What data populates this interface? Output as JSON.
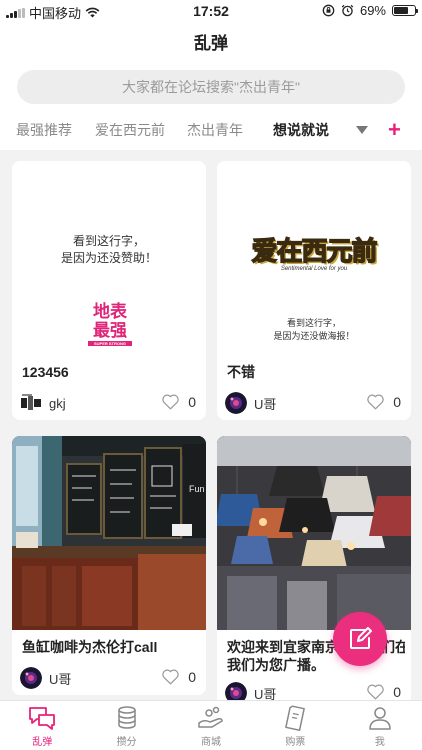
{
  "status_bar": {
    "carrier": "中国移动",
    "time": "17:52",
    "battery": "69%",
    "battery_level": 0.69
  },
  "nav": {
    "title": "乱弹"
  },
  "search": {
    "placeholder": "大家都在论坛搜索\"杰出青年\""
  },
  "tabs": [
    {
      "label": "最强推荐",
      "active": false
    },
    {
      "label": "爱在西元前",
      "active": false
    },
    {
      "label": "杰出青年",
      "active": false
    },
    {
      "label": "想说就说",
      "active": true
    }
  ],
  "tab_add_label": "+",
  "cards": [
    {
      "image_text": [
        "看到这行字，",
        "是因为还没赞助！"
      ],
      "logo_text": [
        "地表",
        "最强"
      ],
      "logo_sub": "SUPER STRONG",
      "title": "123456",
      "author": "gkj",
      "likes": "0"
    },
    {
      "image_text": [
        "看到这行字，",
        "是因为还没做海报！"
      ],
      "logo_text": [
        "爱在西元前"
      ],
      "logo_sub": "Sentimental Love for you",
      "title": "不错",
      "author": "U哥",
      "likes": "0"
    },
    {
      "title": "鱼缸咖啡为杰伦打call",
      "author": "U哥",
      "likes": "0",
      "sign_text": "Fun"
    },
    {
      "title_line1": "欢迎来到宜家南京店，我们在",
      "title_line2": "我们为您广播。",
      "author": "U哥",
      "likes": "0"
    }
  ],
  "tabbar": [
    {
      "label": "乱弹",
      "icon": "chat-bubbles-icon",
      "active": true
    },
    {
      "label": "攒分",
      "icon": "coins-icon",
      "active": false
    },
    {
      "label": "商城",
      "icon": "shop-icon",
      "active": false
    },
    {
      "label": "购票",
      "icon": "ticket-icon",
      "active": false
    },
    {
      "label": "我",
      "icon": "user-icon",
      "active": false
    }
  ],
  "colors": {
    "accent": "#e8227a",
    "fab": "#ec2e7f"
  }
}
